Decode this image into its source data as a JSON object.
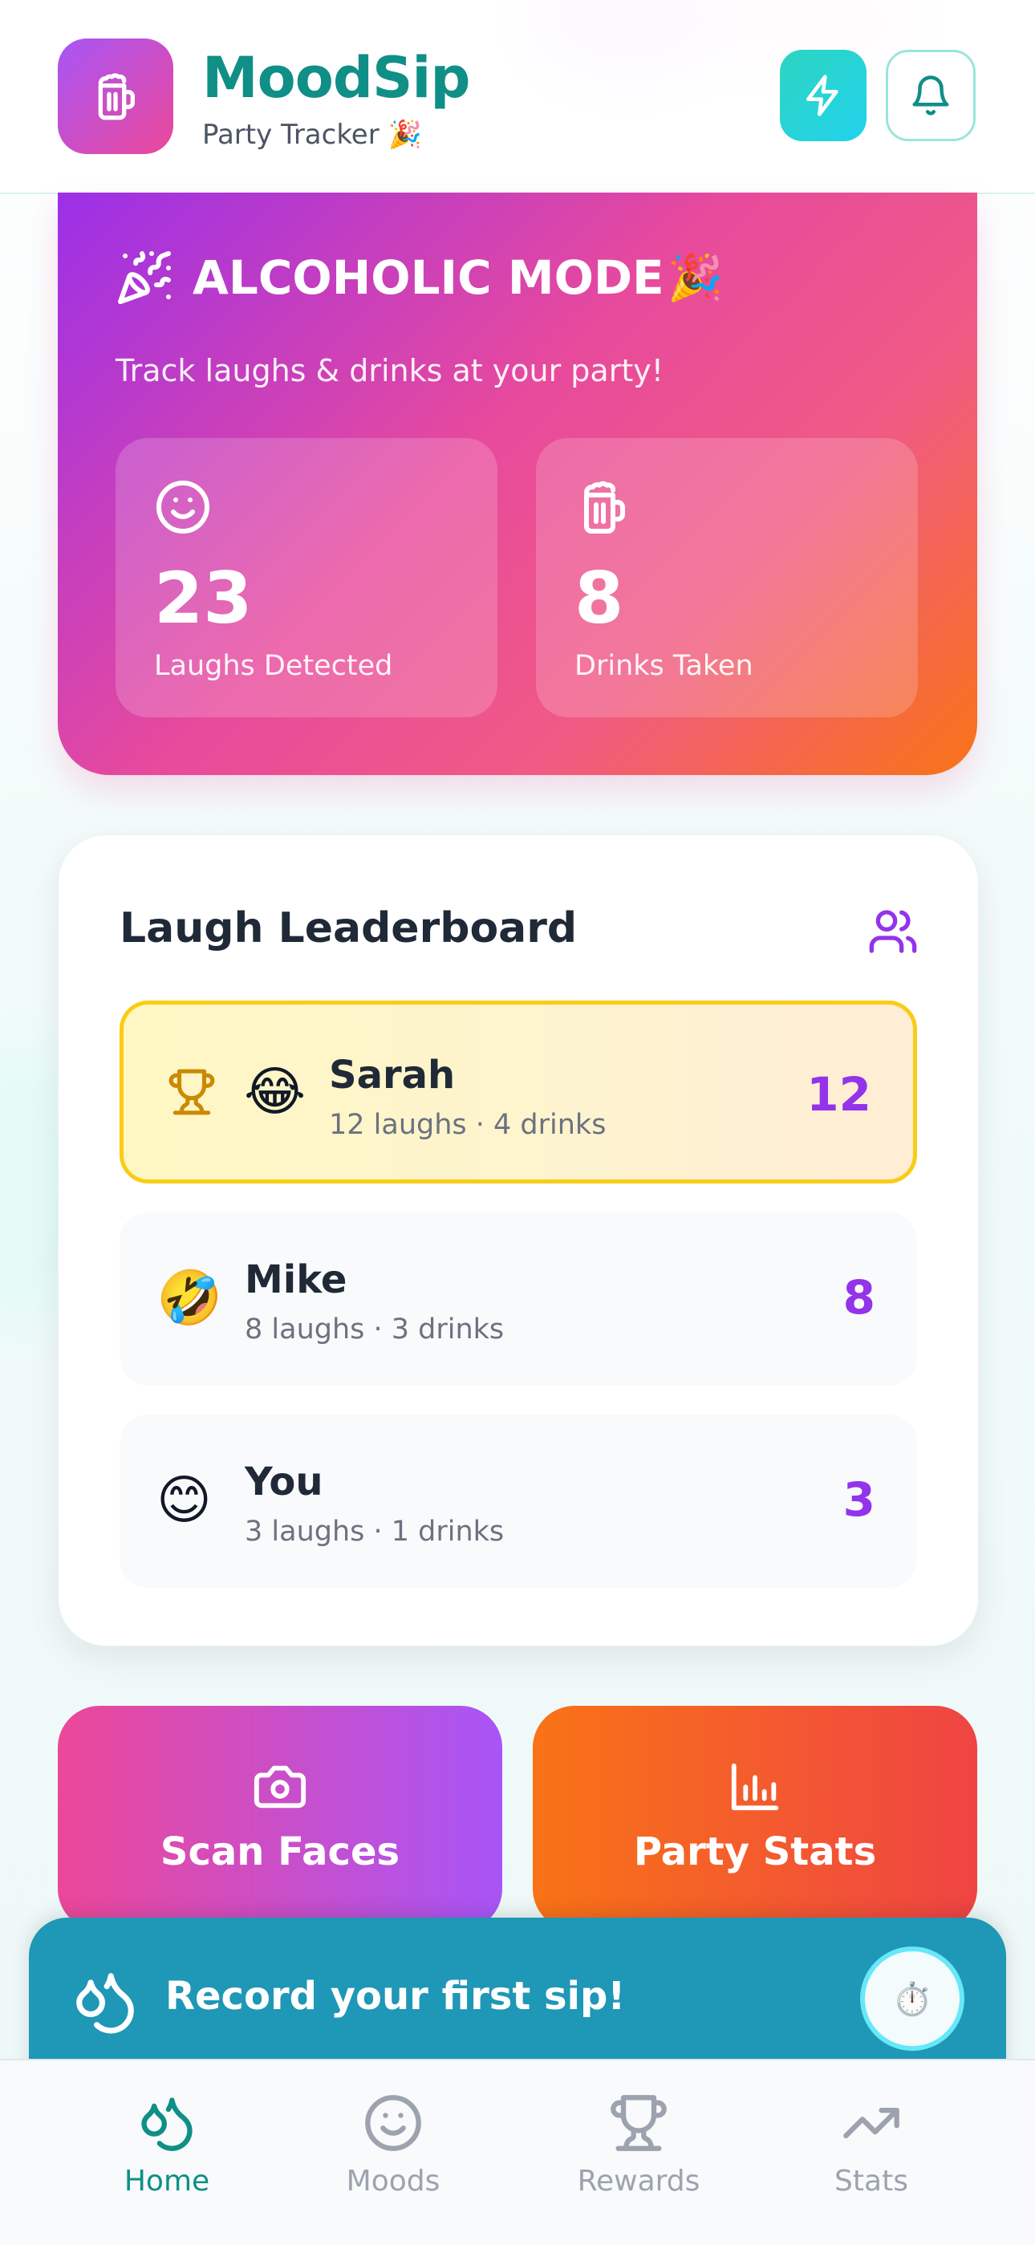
{
  "header": {
    "app_name": "MoodSip",
    "subtitle": "Party Tracker 🎉",
    "icons": {
      "logo": "beer-mug-icon",
      "action": "lightning-bolt-icon",
      "notifications": "bell-icon"
    }
  },
  "hero": {
    "title": "ALCOHOLIC MODE",
    "title_emoji": "🎉",
    "description": "Track laughs & drinks at your party!",
    "stats": [
      {
        "icon": "smile-icon",
        "value": "23",
        "label": "Laughs Detected"
      },
      {
        "icon": "beer-mug-icon",
        "value": "8",
        "label": "Drinks Taken"
      }
    ]
  },
  "leaderboard": {
    "title": "Laugh Leaderboard",
    "icon": "users-icon",
    "entries": [
      {
        "rank_icon": "trophy-icon",
        "emoji": "😂",
        "name": "Sarah",
        "details": "12 laughs · 4 drinks",
        "score": "12"
      },
      {
        "emoji": "🤣",
        "name": "Mike",
        "details": "8 laughs · 3 drinks",
        "score": "8"
      },
      {
        "emoji": "😊",
        "name": "You",
        "details": "3 laughs · 1 drinks",
        "score": "3"
      }
    ]
  },
  "actions": {
    "scan": {
      "label": "Scan Faces",
      "icon": "camera-icon"
    },
    "stats": {
      "label": "Party Stats",
      "icon": "bar-chart-icon"
    }
  },
  "record": {
    "label": "Record your first sip!",
    "icon": "droplets-icon",
    "timer_icon": "⏱️"
  },
  "nav": {
    "items": [
      {
        "label": "Home",
        "icon": "droplets-icon",
        "active": true
      },
      {
        "label": "Moods",
        "icon": "smile-icon"
      },
      {
        "label": "Rewards",
        "icon": "trophy-icon"
      },
      {
        "label": "Stats",
        "icon": "trending-up-icon"
      }
    ]
  },
  "colors": {
    "brand_teal": "#0f8f86",
    "accent_purple": "#9333ea",
    "hero_gradient": [
      "#9b30e8",
      "#e84a9c",
      "#f97316"
    ],
    "record_bar": "#1f97b6"
  }
}
